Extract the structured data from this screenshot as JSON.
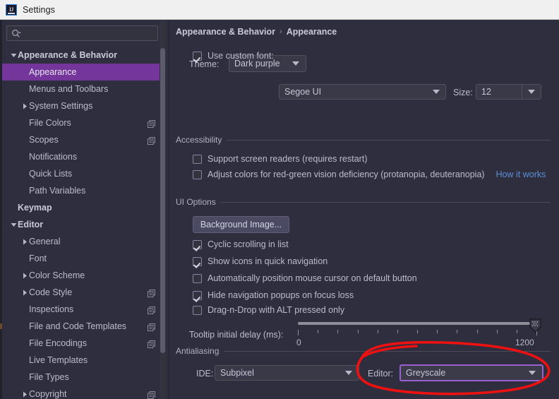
{
  "window": {
    "title": "Settings",
    "app_icon": "intellij-idea-icon"
  },
  "sidebar": {
    "search": {
      "value": "",
      "placeholder": ""
    },
    "items": [
      {
        "label": "Appearance & Behavior",
        "indent": 0,
        "twisty": "down",
        "bold": true,
        "selected": false,
        "copy": false
      },
      {
        "label": "Appearance",
        "indent": 1,
        "twisty": "none",
        "bold": false,
        "selected": true,
        "copy": false
      },
      {
        "label": "Menus and Toolbars",
        "indent": 1,
        "twisty": "none",
        "bold": false,
        "selected": false,
        "copy": false
      },
      {
        "label": "System Settings",
        "indent": 1,
        "twisty": "right",
        "bold": false,
        "selected": false,
        "copy": false
      },
      {
        "label": "File Colors",
        "indent": 1,
        "twisty": "none",
        "bold": false,
        "selected": false,
        "copy": true
      },
      {
        "label": "Scopes",
        "indent": 1,
        "twisty": "none",
        "bold": false,
        "selected": false,
        "copy": true
      },
      {
        "label": "Notifications",
        "indent": 1,
        "twisty": "none",
        "bold": false,
        "selected": false,
        "copy": false
      },
      {
        "label": "Quick Lists",
        "indent": 1,
        "twisty": "none",
        "bold": false,
        "selected": false,
        "copy": false
      },
      {
        "label": "Path Variables",
        "indent": 1,
        "twisty": "none",
        "bold": false,
        "selected": false,
        "copy": false
      },
      {
        "label": "Keymap",
        "indent": 0,
        "twisty": "none",
        "bold": true,
        "selected": false,
        "copy": false
      },
      {
        "label": "Editor",
        "indent": 0,
        "twisty": "down",
        "bold": true,
        "selected": false,
        "copy": false
      },
      {
        "label": "General",
        "indent": 1,
        "twisty": "right",
        "bold": false,
        "selected": false,
        "copy": false
      },
      {
        "label": "Font",
        "indent": 1,
        "twisty": "none",
        "bold": false,
        "selected": false,
        "copy": false
      },
      {
        "label": "Color Scheme",
        "indent": 1,
        "twisty": "right",
        "bold": false,
        "selected": false,
        "copy": false
      },
      {
        "label": "Code Style",
        "indent": 1,
        "twisty": "right",
        "bold": false,
        "selected": false,
        "copy": true
      },
      {
        "label": "Inspections",
        "indent": 1,
        "twisty": "none",
        "bold": false,
        "selected": false,
        "copy": true
      },
      {
        "label": "File and Code Templates",
        "indent": 1,
        "twisty": "none",
        "bold": false,
        "selected": false,
        "copy": true
      },
      {
        "label": "File Encodings",
        "indent": 1,
        "twisty": "none",
        "bold": false,
        "selected": false,
        "copy": true
      },
      {
        "label": "Live Templates",
        "indent": 1,
        "twisty": "none",
        "bold": false,
        "selected": false,
        "copy": false
      },
      {
        "label": "File Types",
        "indent": 1,
        "twisty": "none",
        "bold": false,
        "selected": false,
        "copy": false
      },
      {
        "label": "Copyright",
        "indent": 1,
        "twisty": "right",
        "bold": false,
        "selected": false,
        "copy": true
      }
    ]
  },
  "breadcrumb": {
    "parent": "Appearance & Behavior",
    "separator": "›",
    "current": "Appearance"
  },
  "theme": {
    "label": "Theme:",
    "value": "Dark purple"
  },
  "font": {
    "use_custom_label": "Use custom font:",
    "use_custom_checked": true,
    "family_value": "Segoe UI",
    "size_label": "Size:",
    "size_value": "12"
  },
  "accessibility": {
    "title": "Accessibility",
    "options": [
      {
        "label": "Support screen readers (requires restart)",
        "checked": false
      },
      {
        "label": "Adjust colors for red-green vision deficiency (protanopia, deuteranopia)",
        "checked": false
      }
    ],
    "link": "How it works"
  },
  "ui_options": {
    "title": "UI Options",
    "background_image_button": "Background Image...",
    "options": [
      {
        "label": "Cyclic scrolling in list",
        "checked": true
      },
      {
        "label": "Show icons in quick navigation",
        "checked": true
      },
      {
        "label": "Automatically position mouse cursor on default button",
        "checked": false
      },
      {
        "label": "Hide navigation popups on focus loss",
        "checked": true
      },
      {
        "label": "Drag-n-Drop with ALT pressed only",
        "checked": false
      }
    ],
    "tooltip_label": "Tooltip initial delay (ms):",
    "tooltip_min": "0",
    "tooltip_max": "1200",
    "tooltip_value": 1200
  },
  "antialiasing": {
    "title": "Antialiasing",
    "ide_label": "IDE:",
    "ide_value": "Subpixel",
    "editor_label": "Editor:",
    "editor_value": "Greyscale",
    "editor_focused": true
  },
  "annotation": {
    "shape": "red-ellipse-highlight",
    "color": "#ee1111"
  },
  "colors": {
    "accent_selection": "#75369c",
    "focus_border": "#9a5fd0",
    "link": "#5b8fd6",
    "panel_bg": "#2e2e3e",
    "titlebar_bg": "#f0f0f0"
  }
}
